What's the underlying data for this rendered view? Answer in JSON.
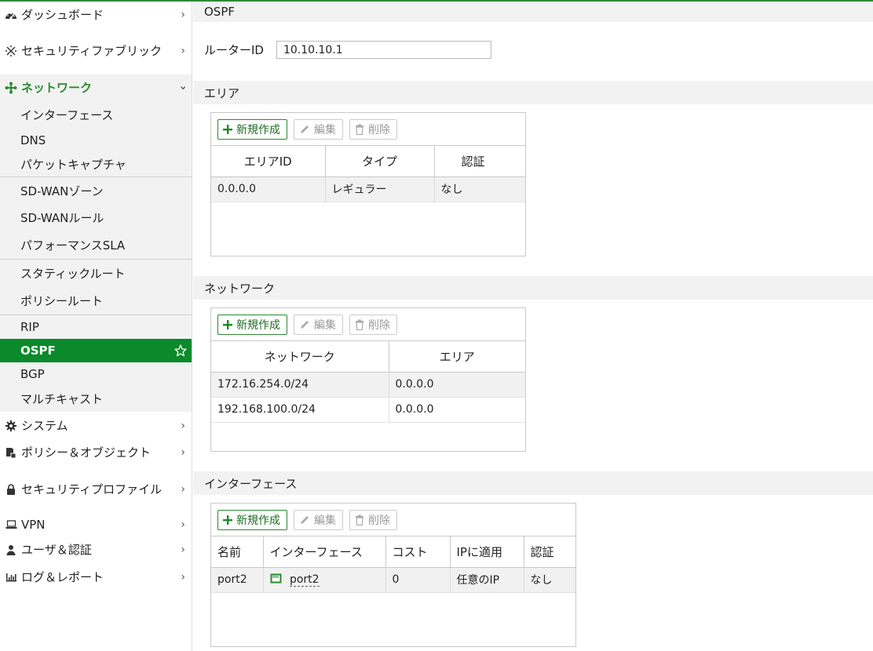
{
  "sidebar": {
    "top_items": [
      {
        "label": "ダッシュボード",
        "icon": "dashboard-icon"
      },
      {
        "label": "セキュリティファブリック",
        "icon": "fabric-icon"
      },
      {
        "label": "ネットワーク",
        "icon": "network-icon"
      }
    ],
    "network_sub": [
      "インターフェース",
      "DNS",
      "パケットキャプチャ",
      "SD-WANゾーン",
      "SD-WANルール",
      "パフォーマンスSLA",
      "スタティックルート",
      "ポリシールート",
      "RIP",
      "OSPF",
      "BGP",
      "マルチキャスト"
    ],
    "bottom_items": [
      {
        "label": "システム",
        "icon": "gear-icon"
      },
      {
        "label": "ポリシー＆オブジェクト",
        "icon": "policy-icon"
      },
      {
        "label": "セキュリティプロファイル",
        "icon": "lock-icon"
      },
      {
        "label": "VPN",
        "icon": "laptop-icon"
      },
      {
        "label": "ユーザ＆認証",
        "icon": "user-icon"
      },
      {
        "label": "ログ＆レポート",
        "icon": "chart-icon"
      }
    ],
    "selected": "OSPF"
  },
  "main": {
    "title": "OSPF",
    "router_id_label": "ルーターID",
    "router_id_value": "10.10.10.1",
    "toolbar": {
      "new": "新規作成",
      "edit": "編集",
      "delete": "削除"
    },
    "area": {
      "title": "エリア",
      "columns": [
        "エリアID",
        "タイプ",
        "認証"
      ],
      "rows": [
        [
          "0.0.0.0",
          "レギュラー",
          "なし"
        ]
      ]
    },
    "network": {
      "title": "ネットワーク",
      "columns": [
        "ネットワーク",
        "エリア"
      ],
      "rows": [
        [
          "172.16.254.0/24",
          "0.0.0.0"
        ],
        [
          "192.168.100.0/24",
          "0.0.0.0"
        ]
      ]
    },
    "interface": {
      "title": "インターフェース",
      "columns": [
        "名前",
        "インターフェース",
        "コスト",
        "IPに適用",
        "認証"
      ],
      "rows": [
        [
          "port2",
          "port2",
          "0",
          "任意のIP",
          "なし"
        ]
      ]
    }
  },
  "colors": {
    "accent": "#0a8a2a",
    "accent_text": "#2a8a2f"
  }
}
